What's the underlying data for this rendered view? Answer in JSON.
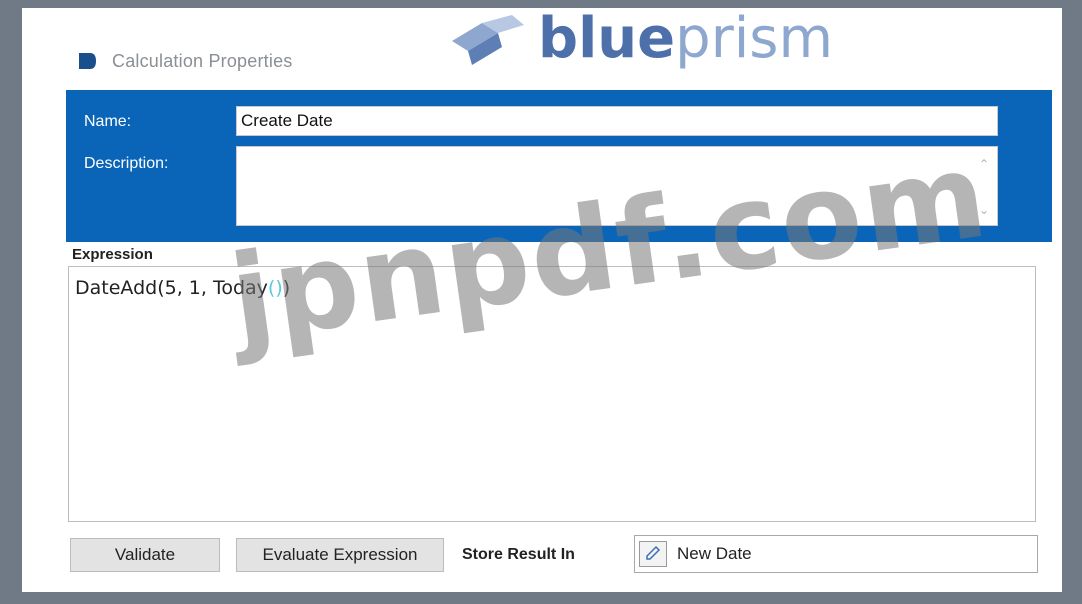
{
  "window": {
    "title": "Calculation Properties"
  },
  "brand": {
    "logo_text_bold": "blue",
    "logo_text_light": "prism"
  },
  "form": {
    "name_label": "Name:",
    "name_value": "Create Date",
    "description_label": "Description:",
    "description_value": ""
  },
  "expression": {
    "label": "Expression",
    "prefix": "DateAdd(5, 1, Today",
    "parens": "()",
    "suffix": ")"
  },
  "actions": {
    "validate_label": "Validate",
    "evaluate_label": "Evaluate Expression",
    "store_label": "Store Result In",
    "store_value": "New Date"
  },
  "watermark": "jpnpdf.com",
  "colors": {
    "header_blue": "#0a64b8",
    "logo_blue": "#5d7fb6",
    "paren_cyan": "#5ac8e0",
    "frame_gray": "#6f7a86"
  }
}
